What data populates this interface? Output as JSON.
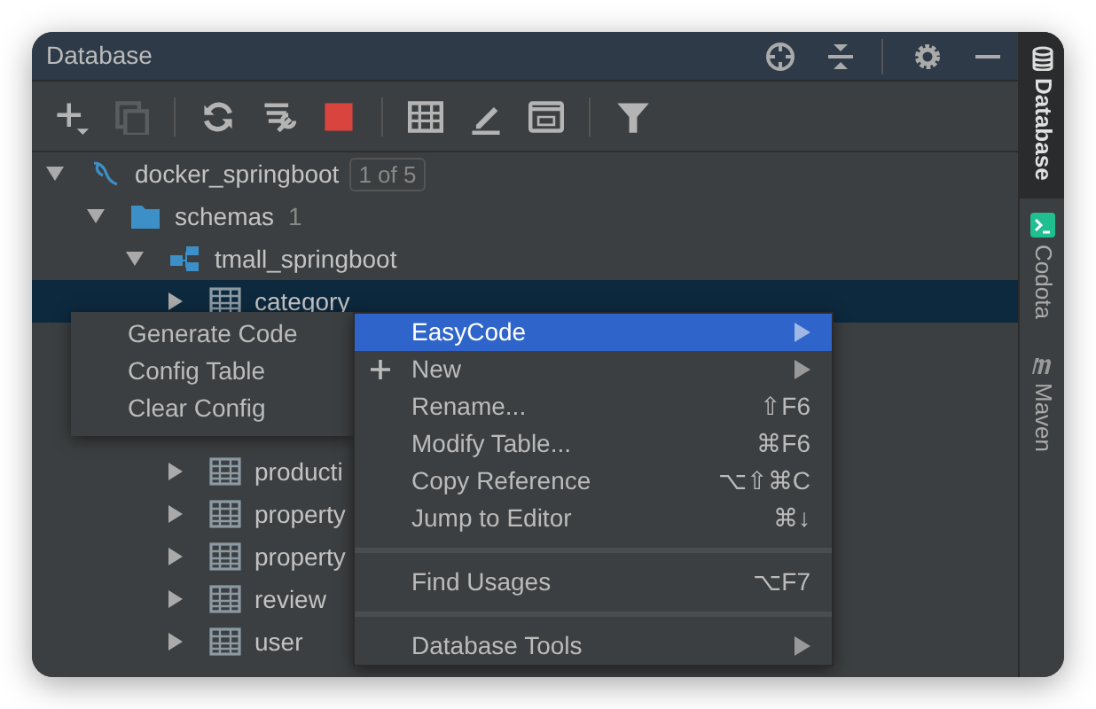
{
  "panel": {
    "title": "Database"
  },
  "toolbar": [
    {
      "kind": "add",
      "disabled": false
    },
    {
      "kind": "copy",
      "disabled": true
    },
    {
      "kind": "separator"
    },
    {
      "kind": "refresh",
      "disabled": false
    },
    {
      "kind": "tools",
      "disabled": false
    },
    {
      "kind": "stop",
      "disabled": false
    },
    {
      "kind": "separator"
    },
    {
      "kind": "table",
      "disabled": false
    },
    {
      "kind": "edit",
      "disabled": false
    },
    {
      "kind": "console",
      "disabled": false
    },
    {
      "kind": "separator"
    },
    {
      "kind": "filter",
      "disabled": false
    }
  ],
  "tree": [
    {
      "label": "docker_springboot",
      "badge": "1 of 5",
      "kind": "datasource",
      "expanded": true,
      "selected": false,
      "children": [
        {
          "label": "schemas",
          "count": "1",
          "kind": "folder",
          "expanded": true,
          "selected": false,
          "children": [
            {
              "label": "tmall_springboot",
              "kind": "schema",
              "expanded": true,
              "selected": false,
              "children": [
                {
                  "label": "category",
                  "kind": "table",
                  "expanded": false,
                  "selected": true
                },
                {
                  "label": "producti",
                  "kind": "table",
                  "expanded": false,
                  "selected": false,
                  "gap_before": true
                },
                {
                  "label": "property",
                  "kind": "table",
                  "expanded": false,
                  "selected": false
                },
                {
                  "label": "property",
                  "kind": "table",
                  "expanded": false,
                  "selected": false
                },
                {
                  "label": "review",
                  "kind": "table",
                  "expanded": false,
                  "selected": false
                },
                {
                  "label": "user",
                  "kind": "table",
                  "expanded": false,
                  "selected": false
                }
              ]
            }
          ]
        }
      ]
    }
  ],
  "submenu": [
    {
      "label": "Generate Code"
    },
    {
      "label": "Config Table"
    },
    {
      "label": "Clear Config"
    }
  ],
  "context_menu": [
    {
      "kind": "item",
      "label": "EasyCode",
      "selected": true,
      "submenu": true
    },
    {
      "kind": "add",
      "label": "New",
      "selected": false,
      "submenu": true
    },
    {
      "kind": "item",
      "label": "Rename...",
      "shortcut": "⇧F6",
      "selected": false,
      "submenu": false
    },
    {
      "kind": "item",
      "label": "Modify Table...",
      "shortcut": "⌘F6",
      "selected": false,
      "submenu": false
    },
    {
      "kind": "item",
      "label": "Copy Reference",
      "shortcut": "⌥⇧⌘C",
      "selected": false,
      "submenu": false
    },
    {
      "kind": "item",
      "label": "Jump to Editor",
      "shortcut": "⌘↓",
      "selected": false,
      "submenu": false
    },
    {
      "kind": "separator"
    },
    {
      "kind": "item",
      "label": "Find Usages",
      "shortcut": "⌥F7",
      "selected": false,
      "submenu": false
    },
    {
      "kind": "separator"
    },
    {
      "kind": "item",
      "label": "Database Tools",
      "selected": false,
      "submenu": true
    }
  ],
  "side_tabs": [
    {
      "kind": "database",
      "label": "Database",
      "selected": true
    },
    {
      "kind": "codota",
      "label": "Codota",
      "selected": false
    },
    {
      "kind": "maven",
      "label": "Maven",
      "selected": false
    }
  ]
}
